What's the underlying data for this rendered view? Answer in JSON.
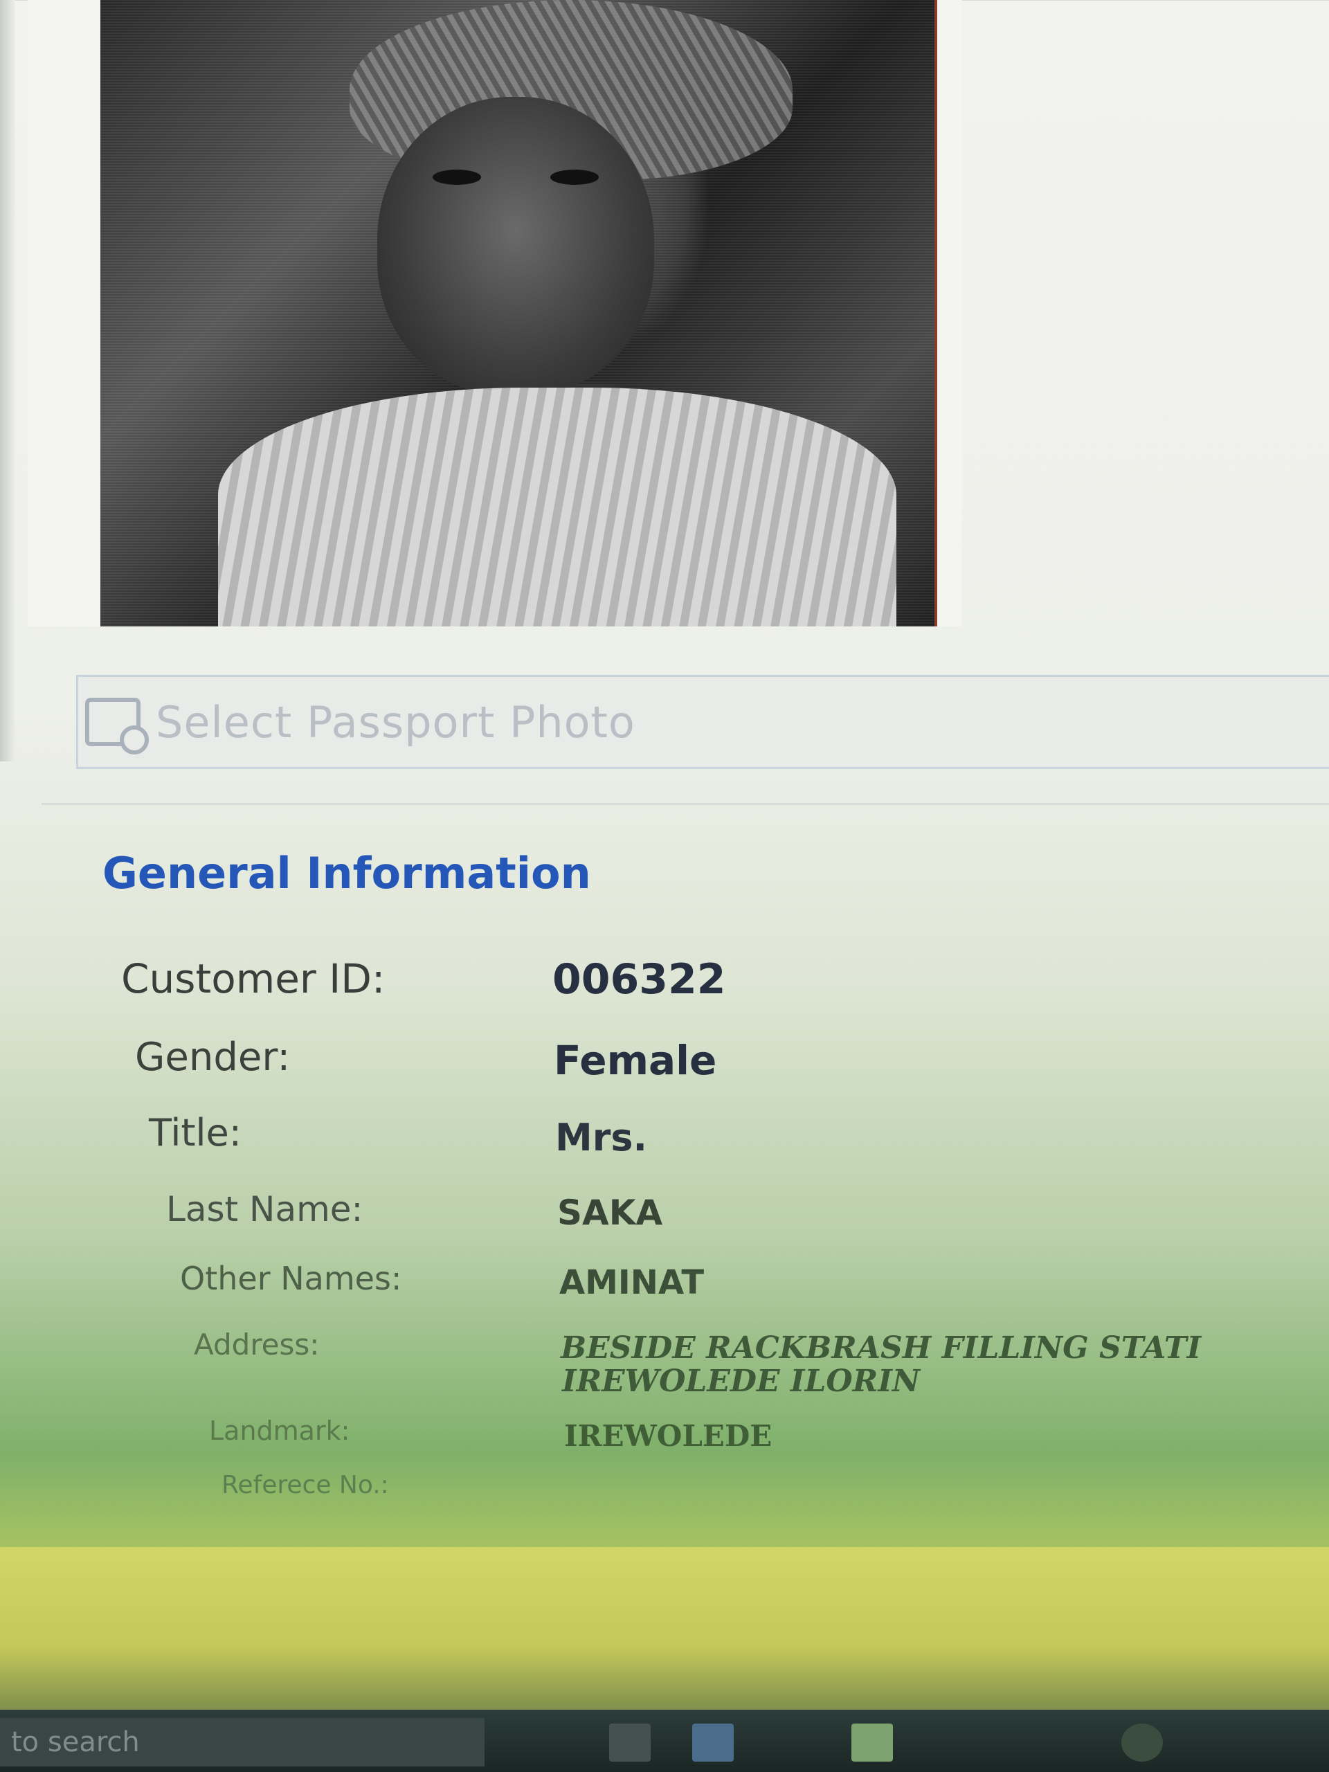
{
  "photo": {
    "select_button_label": "Select Passport Photo"
  },
  "general_info": {
    "title": "General Information",
    "fields": {
      "customer_id": {
        "label": "Customer ID:",
        "value": "006322"
      },
      "gender": {
        "label": "Gender:",
        "value": "Female"
      },
      "title": {
        "label": "Title:",
        "value": "Mrs."
      },
      "last_name": {
        "label": "Last Name:",
        "value": "SAKA"
      },
      "other_names": {
        "label": "Other Names:",
        "value": "AMINAT"
      },
      "address": {
        "label": "Address:",
        "value_line1": "BESIDE RACKBRASH FILLING STATI",
        "value_line2": "IREWOLEDE ILORIN"
      },
      "landmark": {
        "label": "Landmark:",
        "value": "IREWOLEDE"
      },
      "reference_no": {
        "label": "Referece No.:",
        "value": ""
      }
    }
  },
  "taskbar": {
    "search_placeholder": "to search"
  },
  "colors": {
    "section_title": "#2457b8",
    "label_dark": "#3a3f3b",
    "value_dark": "#263040",
    "frame_edge": "#8b3a2e"
  },
  "icons": {
    "select_photo": "photo-select-icon",
    "taskbar_apps": [
      "taskbar-app-icon",
      "taskbar-app-icon",
      "taskbar-app-icon"
    ]
  }
}
